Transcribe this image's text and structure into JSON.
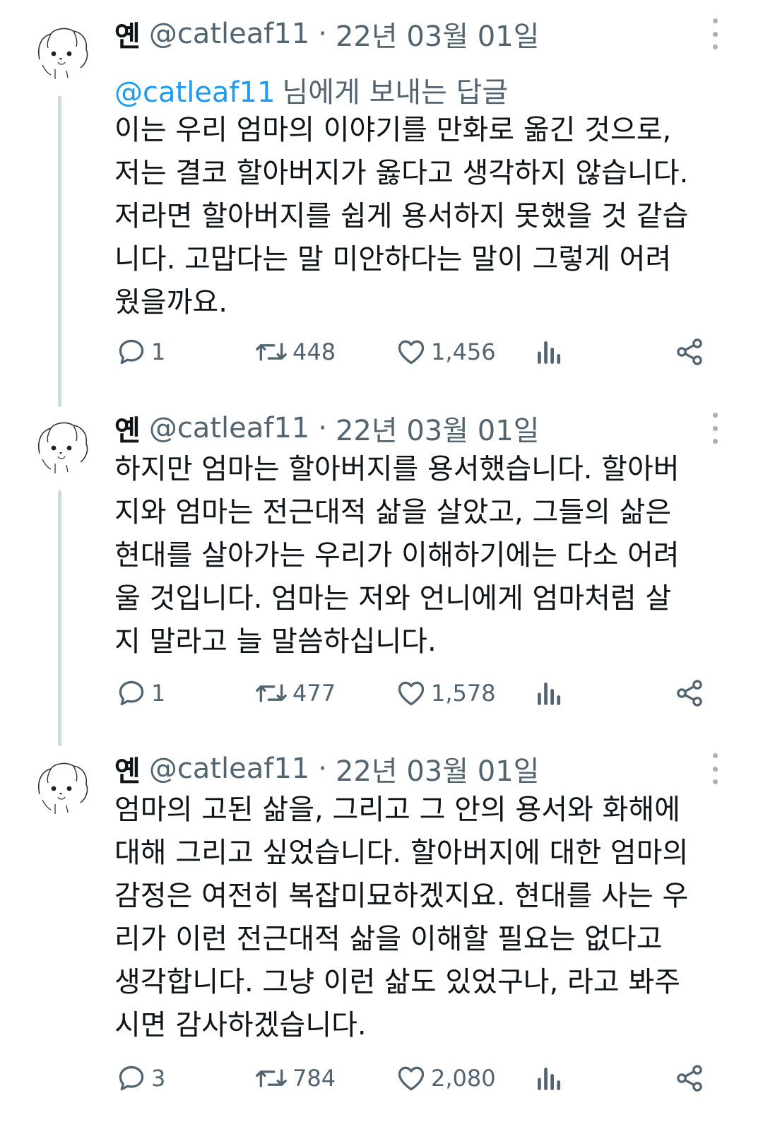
{
  "tweets": [
    {
      "name": "옌",
      "handle": "@catleaf11",
      "separator": "·",
      "date": "22년 03월 01일",
      "reply_to": {
        "mention": "@catleaf11",
        "suffix": "님에게 보내는 답글"
      },
      "lines": [
        "이는 우리 엄마의 이야기를 만화로 옮긴 것으로,",
        "저는 결코 할아버지가 옳다고 생각하지 않습니다.",
        "저라면 할아버지를 쉽게 용서하지 못했을 것 같습",
        "니다. 고맙다는 말 미안하다는 말이 그렇게 어려",
        "웠을까요."
      ],
      "replies": "1",
      "retweets": "448",
      "likes": "1,456"
    },
    {
      "name": "옌",
      "handle": "@catleaf11",
      "separator": "·",
      "date": "22년 03월 01일",
      "lines": [
        "하지만 엄마는 할아버지를 용서했습니다. 할아버",
        "지와 엄마는 전근대적 삶을 살았고, 그들의 삶은",
        "현대를 살아가는 우리가 이해하기에는 다소 어려",
        "울 것입니다. 엄마는 저와 언니에게 엄마처럼 살",
        "지 말라고 늘 말씀하십니다."
      ],
      "replies": "1",
      "retweets": "477",
      "likes": "1,578"
    },
    {
      "name": "옌",
      "handle": "@catleaf11",
      "separator": "·",
      "date": "22년 03월 01일",
      "lines": [
        "엄마의 고된 삶을, 그리고 그 안의 용서와 화해에",
        "대해 그리고 싶었습니다. 할아버지에 대한 엄마의",
        "감정은 여전히 복잡미묘하겠지요. 현대를 사는 우",
        "리가 이런 전근대적 삶을 이해할 필요는 없다고",
        "생각합니다. 그냥 이런 삶도 있었구나, 라고 봐주",
        "시면 감사하겠습니다."
      ],
      "replies": "3",
      "retweets": "784",
      "likes": "2,080"
    }
  ],
  "icons": {
    "avatar": "cat-avatar-icon",
    "more": "more-vertical-icon",
    "reply": "reply-icon",
    "retweet": "retweet-icon",
    "like": "heart-icon",
    "views": "views-icon",
    "share": "share-icon"
  },
  "colors": {
    "mention": "#1d9bf0",
    "muted": "#536471",
    "thread_line": "#cfd9de"
  }
}
